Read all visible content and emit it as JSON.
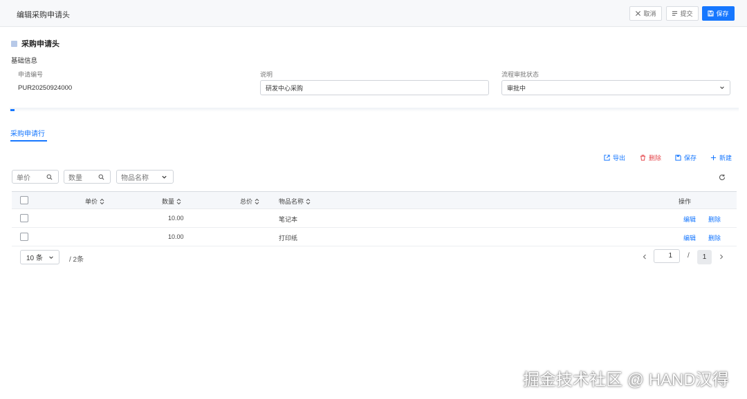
{
  "header": {
    "title": "编辑采购申请头",
    "cancel_label": "取消",
    "submit_label": "提交",
    "save_label": "保存"
  },
  "section": {
    "title": "采购申请头",
    "group_title": "基础信息"
  },
  "fields": {
    "request_no": {
      "label": "申请编号",
      "value": "PUR20250924000"
    },
    "description": {
      "label": "说明",
      "value": "研发中心采购"
    },
    "workflow_status": {
      "label": "流程审批状态",
      "value": "审批中"
    }
  },
  "tabs": [
    {
      "label": "采购申请行"
    }
  ],
  "actions": {
    "export_label": "导出",
    "delete_label": "删除",
    "save_label": "保存",
    "new_label": "新建"
  },
  "filters": {
    "unit_price_placeholder": "单价",
    "quantity_placeholder": "数量",
    "item_name_placeholder": "物品名称"
  },
  "table": {
    "columns": {
      "unit_price": "单价",
      "quantity": "数量",
      "total_price": "总价",
      "item_name": "物品名称",
      "operation": "操作"
    },
    "rows": [
      {
        "unit_price": "",
        "quantity": "10.00",
        "total_price": "",
        "item_name": "笔记本",
        "edit": "编辑",
        "delete": "删除"
      },
      {
        "unit_price": "",
        "quantity": "10.00",
        "total_price": "",
        "item_name": "打印纸",
        "edit": "编辑",
        "delete": "删除"
      }
    ]
  },
  "pagination": {
    "page_size": "10 条",
    "total": "/ 2条",
    "current_input": "1",
    "slash": "/",
    "total_pages": "1"
  },
  "watermark": "掘金技术社区 @ HAND汉得",
  "colors": {
    "primary": "#1677ff",
    "danger": "#e5484d"
  }
}
